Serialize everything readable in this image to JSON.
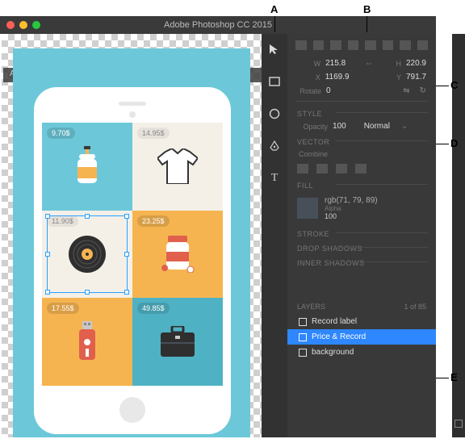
{
  "window": {
    "title": "Adobe Photoshop CC 2015",
    "document_tab": "App Ideas.psd"
  },
  "callouts": {
    "A": "A",
    "B": "B",
    "C": "C",
    "D": "D",
    "E": "E"
  },
  "tiles": [
    {
      "price": "9.70$"
    },
    {
      "price": "14.95$"
    },
    {
      "price": "11.90$"
    },
    {
      "price": "23.25$"
    },
    {
      "price": "17.55$"
    },
    {
      "price": "49.85$"
    }
  ],
  "tools": {
    "move": "move-tool",
    "rect": "rectangle-tool",
    "ellipse": "ellipse-tool",
    "pen": "pen-tool",
    "type": "type-tool"
  },
  "transform": {
    "W": "215.8",
    "H": "220.9",
    "X": "1169.9",
    "Y": "791.7",
    "rotate_label": "Rotate",
    "rotate": "0"
  },
  "style": {
    "heading": "STYLE",
    "opacity_label": "Opacity",
    "opacity": "100",
    "blend": "Normal"
  },
  "vector": {
    "heading": "VECTOR",
    "combine_label": "Combine"
  },
  "fill": {
    "heading": "FILL",
    "color_label": "rgb(71, 79, 89)",
    "alpha_label": "Alpha",
    "alpha": "100",
    "swatch_hex": "#474f59"
  },
  "stroke": {
    "heading": "STROKE"
  },
  "drop_shadows": {
    "heading": "DROP SHADOWS"
  },
  "inner_shadows": {
    "heading": "INNER SHADOWS"
  },
  "layers": {
    "heading": "LAYERS",
    "count": "1 of 85",
    "items": [
      {
        "name": "Record label",
        "selected": false
      },
      {
        "name": "Price & Record",
        "selected": true
      },
      {
        "name": "background",
        "selected": false
      }
    ]
  }
}
